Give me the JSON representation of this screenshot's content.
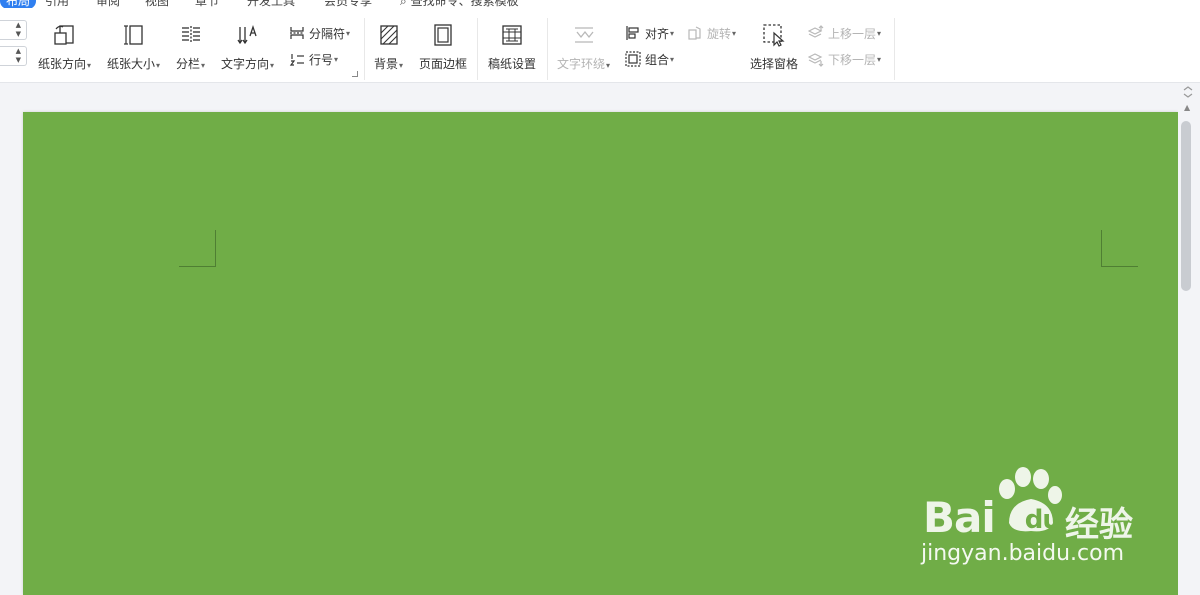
{
  "menu": {
    "tabs": [
      "布局",
      "引用",
      "审阅",
      "视图",
      "章节",
      "开发工具",
      "会员专享"
    ],
    "search_text": "查找命令、搜索模板"
  },
  "ribbon": {
    "paper_orientation": "纸张方向",
    "paper_size": "纸张大小",
    "columns": "分栏",
    "text_direction": "文字方向",
    "separator": "分隔符",
    "line_number": "行号",
    "background": "背景",
    "page_border": "页面边框",
    "manuscript_setup": "稿纸设置",
    "text_wrap": "文字环绕",
    "align": "对齐",
    "rotate": "旋转",
    "group": "组合",
    "selection_pane": "选择窗格",
    "bring_forward": "上移一层",
    "send_backward": "下移一层"
  },
  "document": {
    "page_background_color": "#70ad47"
  },
  "watermark": {
    "brand": "Bai",
    "brand_du": "du",
    "jingyan": "经验",
    "url": "jingyan.baidu.com"
  },
  "colors": {
    "accent": "#2f7ff0",
    "page_green": "#70ad47"
  }
}
